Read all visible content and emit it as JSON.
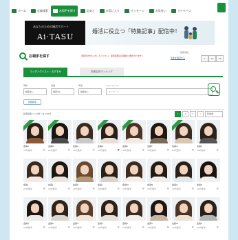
{
  "nav": {
    "items": [
      {
        "label": "ホーム",
        "active": false
      },
      {
        "label": "会員検索",
        "active": false
      },
      {
        "label": "お相手を探す",
        "active": true
      },
      {
        "label": "足あと",
        "active": false
      },
      {
        "label": "お気に入り",
        "active": false
      },
      {
        "label": "メッセージ",
        "active": false
      },
      {
        "label": "お見合い",
        "active": false
      },
      {
        "label": "マイページ",
        "active": false
      }
    ]
  },
  "banner": {
    "tagline": "あなたのための婚活サポート",
    "brand": "Ai·TASU",
    "message": "婚活に役立つ「特集記事」配信中！"
  },
  "search": {
    "title": "お相手を探す",
    "notice": "（検索条件を入力してください。検索結果は定期的に更新されます）",
    "count_label": "検索件数",
    "count_link": "条件を保存する",
    "count_cells": [
      "1",
      "10",
      "15"
    ],
    "tabs": [
      {
        "label": "マッチングリスト・おすすめ",
        "active": true
      },
      {
        "label": "新着会員ランキング",
        "active": false
      }
    ],
    "filters": [
      {
        "label": "年齢",
        "value": "指定なし"
      },
      {
        "label": "身長",
        "value": "指定なし"
      },
      {
        "label": "年収",
        "value": "指定なし"
      }
    ],
    "keyword_label": "フリーワード",
    "keyword_placeholder": "キーワード",
    "more_label": "詳細検索"
  },
  "results": {
    "info": "検索結果 1〜24件 / 全 100件",
    "pages": [
      "1",
      "2",
      "3",
      ">"
    ],
    "sort": "新着順"
  },
  "members": [
    {
      "l1": "会員A",
      "l2": "30代前半",
      "hair": "#2a2018",
      "top": "#8a5a3a",
      "ribbon": true,
      "fav": false
    },
    {
      "l1": "会員B",
      "l2": "20代後半",
      "hair": "#1a1410",
      "top": "#4a4a4a",
      "ribbon": true,
      "fav": false
    },
    {
      "l1": "会員C",
      "l2": "30代後半",
      "hair": "#3b2a1d",
      "top": "#c9c9c9",
      "ribbon": false,
      "fav": false
    },
    {
      "l1": "会員D",
      "l2": "20代後半",
      "hair": "#2a1f18",
      "top": "#e7dfd8",
      "ribbon": true,
      "fav": true
    },
    {
      "l1": "会員E",
      "l2": "30代前半",
      "hair": "#4a3426",
      "top": "#f1ebe3",
      "ribbon": true,
      "fav": false
    },
    {
      "l1": "会員F",
      "l2": "30代前半",
      "hair": "#1e1712",
      "top": "#7a6a5a",
      "ribbon": false,
      "fav": false
    },
    {
      "l1": "会員G",
      "l2": "20代後半",
      "hair": "#3a2a20",
      "top": "#d8c7b2",
      "ribbon": true,
      "fav": false
    },
    {
      "l1": "会員H",
      "l2": "30代前半",
      "hair": "#2b211a",
      "top": "#555555",
      "ribbon": false,
      "fav": false
    },
    {
      "l1": "会員I",
      "l2": "20代後半",
      "hair": "#3a2a1e",
      "top": "#f2ece6",
      "ribbon": false,
      "fav": false
    },
    {
      "l1": "会員J",
      "l2": "30代前半",
      "hair": "#1c1610",
      "top": "#eae6e2",
      "ribbon": false,
      "fav": false
    },
    {
      "l1": "会員K",
      "l2": "20代後半",
      "hair": "#6a4a32",
      "top": "#b89878",
      "ribbon": false,
      "fav": false
    },
    {
      "l1": "会員L",
      "l2": "30代後半",
      "hair": "#2a1f17",
      "top": "#d9d3cc",
      "ribbon": false,
      "fav": false
    },
    {
      "l1": "会員M",
      "l2": "20代後半",
      "hair": "#3e2c20",
      "top": "#f5f0ea",
      "ribbon": false,
      "fav": false
    },
    {
      "l1": "会員N",
      "l2": "30代前半",
      "hair": "#221a14",
      "top": "#efefef",
      "ribbon": false,
      "fav": false
    },
    {
      "l1": "会員O",
      "l2": "30代前半",
      "hair": "#2c2118",
      "top": "#e4e8ec",
      "ribbon": false,
      "fav": false
    },
    {
      "l1": "会員P",
      "l2": "20代後半",
      "hair": "#1a1410",
      "top": "#f1f1f1",
      "ribbon": false,
      "fav": false
    },
    {
      "l1": "会員Q",
      "l2": "30代前半",
      "hair": "#1e1711",
      "top": "#ecebea",
      "ribbon": false,
      "fav": false
    },
    {
      "l1": "会員R",
      "l2": "20代後半",
      "hair": "#2e2219",
      "top": "#d9d6d2",
      "ribbon": false,
      "fav": false
    },
    {
      "l1": "会員S",
      "l2": "30代後半",
      "hair": "#5a3e2b",
      "top": "#f0e6dc",
      "ribbon": false,
      "fav": false
    },
    {
      "l1": "会員T",
      "l2": "30代前半",
      "hair": "#2a2018",
      "top": "#e6e0da",
      "ribbon": false,
      "fav": false
    },
    {
      "l1": "会員U",
      "l2": "20代後半",
      "hair": "#3a2b20",
      "top": "#f3efeb",
      "ribbon": false,
      "fav": false
    },
    {
      "l1": "会員V",
      "l2": "30代前半",
      "hair": "#1d1611",
      "top": "#c8b6a4",
      "ribbon": false,
      "fav": false
    },
    {
      "l1": "会員W",
      "l2": "20代後半",
      "hair": "#4a3426",
      "top": "#f0e2d4",
      "ribbon": false,
      "fav": false
    },
    {
      "l1": "会員X",
      "l2": "30代前半",
      "hair": "#2a1f17",
      "top": "#b5b5b5",
      "ribbon": false,
      "fav": false
    }
  ]
}
